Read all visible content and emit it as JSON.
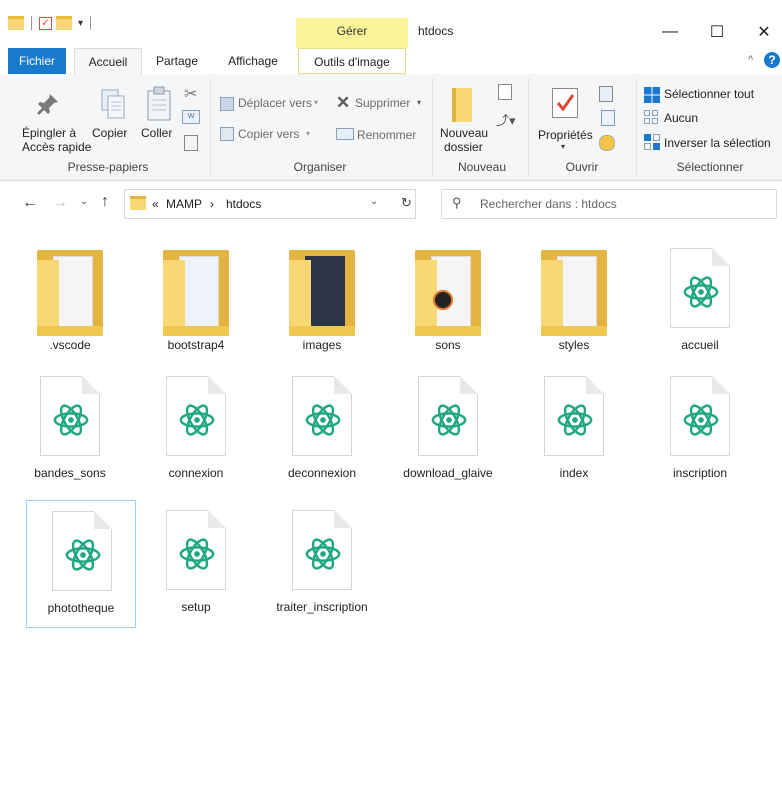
{
  "titlebar": {
    "context_group": "Gérer",
    "window_title": "htdocs",
    "controls": {
      "minimize": "—",
      "maximize": "☐",
      "close": "✕"
    }
  },
  "tabs": {
    "file": "Fichier",
    "home": "Accueil",
    "share": "Partage",
    "view": "Affichage",
    "picture_tools": "Outils d'image"
  },
  "ribbon": {
    "clipboard": {
      "pin": "Épingler à",
      "pin2": "Accès rapide",
      "copy": "Copier",
      "paste": "Coller",
      "label": "Presse-papiers"
    },
    "organize": {
      "move_to": "Déplacer vers",
      "copy_to": "Copier vers",
      "delete": "Supprimer",
      "rename": "Renommer",
      "label": "Organiser"
    },
    "new": {
      "new_folder": "Nouveau",
      "new_folder2": "dossier",
      "label": "Nouveau"
    },
    "open": {
      "properties": "Propriétés",
      "label": "Ouvrir"
    },
    "select": {
      "select_all": "Sélectionner tout",
      "select_none": "Aucun",
      "invert": "Inverser la sélection",
      "label": "Sélectionner"
    }
  },
  "address": {
    "chevrons": "«",
    "crumb1": "MAMP",
    "sep": "›",
    "crumb2": "htdocs",
    "search_placeholder": "Rechercher dans : htdocs"
  },
  "items": [
    {
      "name": ".vscode",
      "type": "folder"
    },
    {
      "name": "bootstrap4",
      "type": "folder"
    },
    {
      "name": "images",
      "type": "folder"
    },
    {
      "name": "sons",
      "type": "folder"
    },
    {
      "name": "styles",
      "type": "folder"
    },
    {
      "name": "accueil",
      "type": "atom-file"
    },
    {
      "name": "bandes_sons",
      "type": "atom-file"
    },
    {
      "name": "connexion",
      "type": "atom-file"
    },
    {
      "name": "deconnexion",
      "type": "atom-file"
    },
    {
      "name": "download_glaive",
      "type": "atom-file"
    },
    {
      "name": "index",
      "type": "atom-file"
    },
    {
      "name": "inscription",
      "type": "atom-file"
    },
    {
      "name": "phototheque",
      "type": "atom-file",
      "selected": true
    },
    {
      "name": "setup",
      "type": "atom-file"
    },
    {
      "name": "traiter_inscription",
      "type": "atom-file"
    }
  ],
  "colors": {
    "accent": "#1979ca",
    "atom_green": "#1fa882",
    "folder_yellow": "#f8d775",
    "context_tab": "#fbf49b"
  }
}
